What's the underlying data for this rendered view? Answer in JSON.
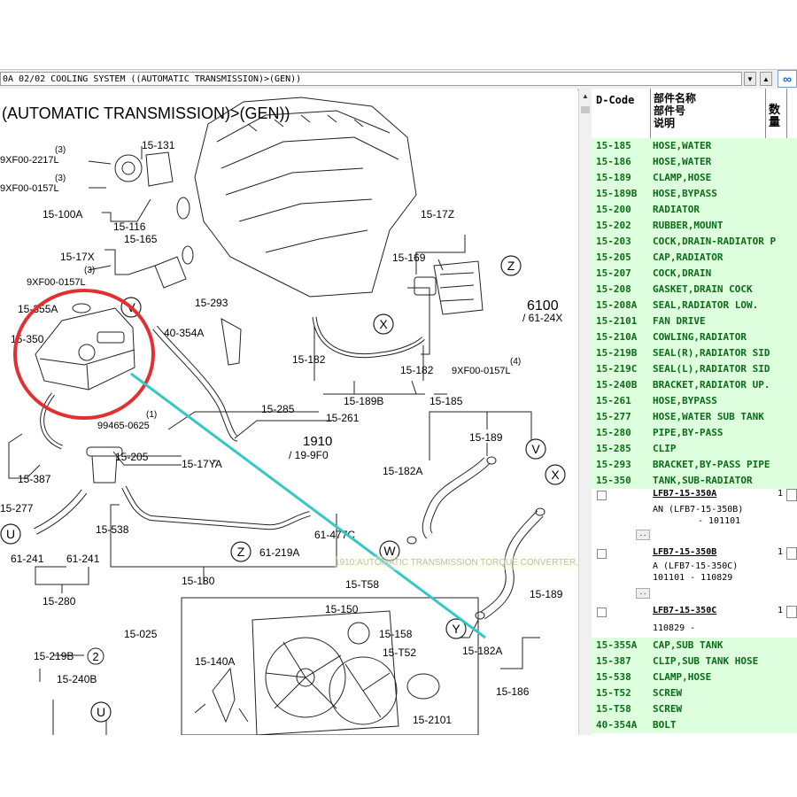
{
  "toolbar": {
    "path": "0A 02/02 COOLING SYSTEM ((AUTOMATIC TRANSMISSION)>(GEN))",
    "dropdown_glyph": "▼",
    "up_glyph": "▲",
    "link_icon": "link-icon"
  },
  "diagram": {
    "title": "(AUTOMATIC TRANSMISSION)>(GEN))",
    "labels": {
      "l15_131": "15-131",
      "l9xf2217": "9XF00-2217L",
      "l9xf0157a": "9XF00-0157L",
      "q3a": "(3)",
      "q3b": "(3)",
      "q3c": "(3)",
      "l15_100a": "15-100A",
      "l15_116": "15-116",
      "l15_165": "15-165",
      "l15_17x": "15-17X",
      "l9xf0157b": "9XF00-0157L",
      "l15_355a": "15-355A",
      "l15_350": "15-350",
      "l15_293": "15-293",
      "l40_354a": "40-354A",
      "l15_17z": "15-17Z",
      "l15_169": "15-169",
      "l6100": "6100",
      "l61_24x": "/ 61-24X",
      "l15_182a": "15-182",
      "l15_182b": "15-182",
      "l15_189b": "15-189B",
      "l9xf0157c": "9XF00-0157L",
      "q4": "(4)",
      "l15_285": "15-285",
      "l15_261": "15-261",
      "l15_185": "15-185",
      "l99465": "99465-0625",
      "q1": "(1)",
      "l1910": "1910",
      "l19_9f0": "/ 19-9F0",
      "l15_189": "15-189",
      "l15_205": "15-205",
      "l15_17ya": "15-17YA",
      "l15_387": "15-387",
      "l15_277": "15-277",
      "l15_182aa": "15-182A",
      "l15_538": "15-538",
      "l61_477c": "61-477C",
      "l61_219a": "61-219A",
      "l61_241a": "61-241",
      "l61_241b": "61-241",
      "l15_180": "15-180",
      "l15_280": "15-280",
      "l15_t58": "15-T58",
      "l15_150": "15-150",
      "l15_158": "15-158",
      "l15_025": "15-025",
      "l15_140a": "15-140A",
      "l15_t52": "15-T52",
      "l15_182ab": "15-182A",
      "l15_189c": "15-189",
      "l15_186": "15-186",
      "l15_2101": "15-2101",
      "l15_219b": "15-219B",
      "l15_240b": "15-240B",
      "q2": "2",
      "zV1": "V",
      "zV2": "V",
      "zX1": "X",
      "zX2": "X",
      "zZ1": "Z",
      "zZ2": "Z",
      "zU1": "U",
      "zU2": "U",
      "zW": "W",
      "zY": "Y"
    },
    "tooltip": "1910:AUTOMATIC TRANSMISSION TORQUE CONVERTER, OIL PUMP & PIPING"
  },
  "parts_header": {
    "dcode": "D-Code",
    "name_line1": "部件名称",
    "name_line2": "部件号",
    "name_line3": "说明",
    "qty": "数量"
  },
  "parts": [
    {
      "code": "15-185",
      "name": "HOSE,WATER"
    },
    {
      "code": "15-186",
      "name": "HOSE,WATER"
    },
    {
      "code": "15-189",
      "name": "CLAMP,HOSE"
    },
    {
      "code": "15-189B",
      "name": "HOSE,BYPASS"
    },
    {
      "code": "15-200",
      "name": "RADIATOR"
    },
    {
      "code": "15-202",
      "name": "RUBBER,MOUNT"
    },
    {
      "code": "15-203",
      "name": "COCK,DRAIN-RADIATOR P"
    },
    {
      "code": "15-205",
      "name": "CAP,RADIATOR"
    },
    {
      "code": "15-207",
      "name": "COCK,DRAIN"
    },
    {
      "code": "15-208",
      "name": "GASKET,DRAIN COCK"
    },
    {
      "code": "15-208A",
      "name": "SEAL,RADIATOR LOW."
    },
    {
      "code": "15-2101",
      "name": "FAN DRIVE"
    },
    {
      "code": "15-210A",
      "name": "COWLING,RADIATOR"
    },
    {
      "code": "15-219B",
      "name": "SEAL(R),RADIATOR SID"
    },
    {
      "code": "15-219C",
      "name": "SEAL(L),RADIATOR SID"
    },
    {
      "code": "15-240B",
      "name": "BRACKET,RADIATOR UP."
    },
    {
      "code": "15-261",
      "name": "HOSE,BYPASS"
    },
    {
      "code": "15-277",
      "name": "HOSE,WATER SUB TANK"
    },
    {
      "code": "15-280",
      "name": "PIPE,BY-PASS"
    },
    {
      "code": "15-285",
      "name": "CLIP"
    },
    {
      "code": "15-293",
      "name": "BRACKET,BY-PASS PIPE"
    },
    {
      "code": "15-350",
      "name": "TANK,SUB-RADIATOR"
    }
  ],
  "subparts": [
    {
      "pn": "LFB7-15-350A",
      "qty": "1",
      "line2": "AN (LFB7-15-350B)",
      "line3": "- 101101"
    },
    {
      "pn": "LFB7-15-350B",
      "qty": "1",
      "line2": "A (LFB7-15-350C)",
      "line3": "101101  - 110829"
    },
    {
      "pn": "LFB7-15-350C",
      "qty": "1",
      "line2": "110829  -",
      "line3": ""
    }
  ],
  "mini_btn": "..",
  "parts2": [
    {
      "code": "15-355A",
      "name": "CAP,SUB TANK"
    },
    {
      "code": "15-387",
      "name": "CLIP,SUB TANK HOSE"
    },
    {
      "code": "15-538",
      "name": "CLAMP,HOSE"
    },
    {
      "code": "15-T52",
      "name": "SCREW"
    },
    {
      "code": "15-T58",
      "name": "SCREW"
    },
    {
      "code": "40-354A",
      "name": "BOLT"
    }
  ],
  "colors": {
    "highlight_circle": "#e23030",
    "pointer_line": "#33c8c8",
    "parts_bg": "#ddffdd",
    "parts_text": "#0b6b18"
  }
}
